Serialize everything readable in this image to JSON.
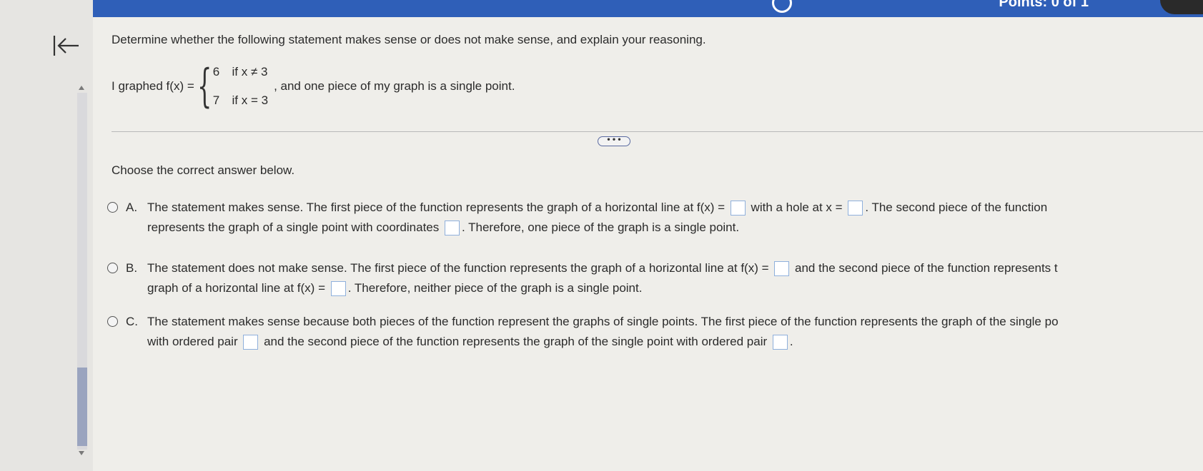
{
  "header": {
    "points_label": "Points: 0 of 1"
  },
  "nav": {
    "back_icon": "arrow-left-bar-icon"
  },
  "question": {
    "prompt": "Determine whether the following statement makes sense or does not make sense, and explain your reasoning.",
    "statement_prefix": "I graphed f(x) =",
    "cases": [
      {
        "value": "6",
        "condition": "if x ≠ 3"
      },
      {
        "value": "7",
        "condition": "if x = 3"
      }
    ],
    "statement_suffix": ", and one piece of my graph is a single point.",
    "more_button": "• • •",
    "instruction": "Choose the correct answer below."
  },
  "options": [
    {
      "letter": "A.",
      "lines": [
        [
          "The statement makes sense. The first piece of the function represents the graph of a horizontal line at f(x) =",
          "BOX",
          "with a hole at x =",
          "BOX",
          ". The second piece of the function"
        ],
        [
          "represents the graph of a single point with coordinates",
          "BOX",
          ". Therefore, one piece of the graph is a single point."
        ]
      ]
    },
    {
      "letter": "B.",
      "lines": [
        [
          "The statement does not make sense. The first piece of the function represents the graph of a horizontal line at f(x) =",
          "BOX",
          "and the second piece of the function represents t"
        ],
        [
          "graph of a horizontal line at f(x) =",
          "BOX",
          ". Therefore, neither piece of the graph is a single point."
        ]
      ]
    },
    {
      "letter": "C.",
      "lines": [
        [
          "The statement makes sense because both pieces of the function represent the graphs of single points. The first piece of the function represents the graph of the single po"
        ],
        [
          "with ordered pair",
          "BOX",
          "and the second piece of the function represents the graph of the single point with ordered pair",
          "BOX",
          "."
        ]
      ]
    }
  ]
}
